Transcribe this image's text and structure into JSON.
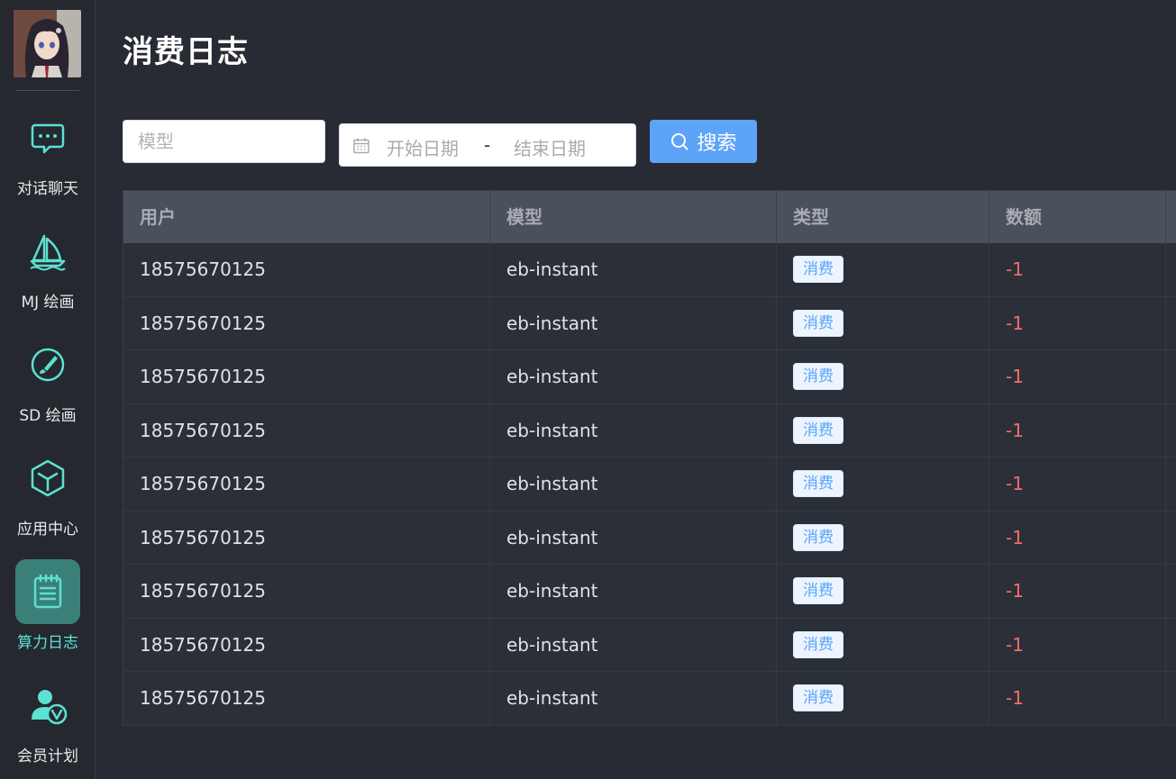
{
  "sidebar": {
    "items": [
      {
        "label": "对话聊天",
        "icon": "chat-bubble-icon"
      },
      {
        "label": "MJ 绘画",
        "icon": "sailboat-icon"
      },
      {
        "label": "SD 绘画",
        "icon": "brush-icon"
      },
      {
        "label": "应用中心",
        "icon": "cube-icon"
      },
      {
        "label": "算力日志",
        "icon": "notepad-icon",
        "active": true
      },
      {
        "label": "会员计划",
        "icon": "vip-user-icon"
      }
    ]
  },
  "page": {
    "title": "消费日志"
  },
  "filters": {
    "model_placeholder": "模型",
    "start_date_placeholder": "开始日期",
    "separator": "-",
    "end_date_placeholder": "结束日期",
    "search_label": "搜索"
  },
  "table": {
    "headers": [
      "用户",
      "模型",
      "类型",
      "数额"
    ],
    "rows": [
      {
        "user": "18575670125",
        "model": "eb-instant",
        "type": "消费",
        "amount": "-1"
      },
      {
        "user": "18575670125",
        "model": "eb-instant",
        "type": "消费",
        "amount": "-1"
      },
      {
        "user": "18575670125",
        "model": "eb-instant",
        "type": "消费",
        "amount": "-1"
      },
      {
        "user": "18575670125",
        "model": "eb-instant",
        "type": "消费",
        "amount": "-1"
      },
      {
        "user": "18575670125",
        "model": "eb-instant",
        "type": "消费",
        "amount": "-1"
      },
      {
        "user": "18575670125",
        "model": "eb-instant",
        "type": "消费",
        "amount": "-1"
      },
      {
        "user": "18575670125",
        "model": "eb-instant",
        "type": "消费",
        "amount": "-1"
      },
      {
        "user": "18575670125",
        "model": "eb-instant",
        "type": "消费",
        "amount": "-1"
      },
      {
        "user": "18575670125",
        "model": "eb-instant",
        "type": "消费",
        "amount": "-1"
      }
    ]
  },
  "colors": {
    "background": "#282b33",
    "accent": "#5ce1d2",
    "active_bg": "#3b8078",
    "primary_button": "#5da3f7",
    "negative_amount": "#f56c6c"
  }
}
